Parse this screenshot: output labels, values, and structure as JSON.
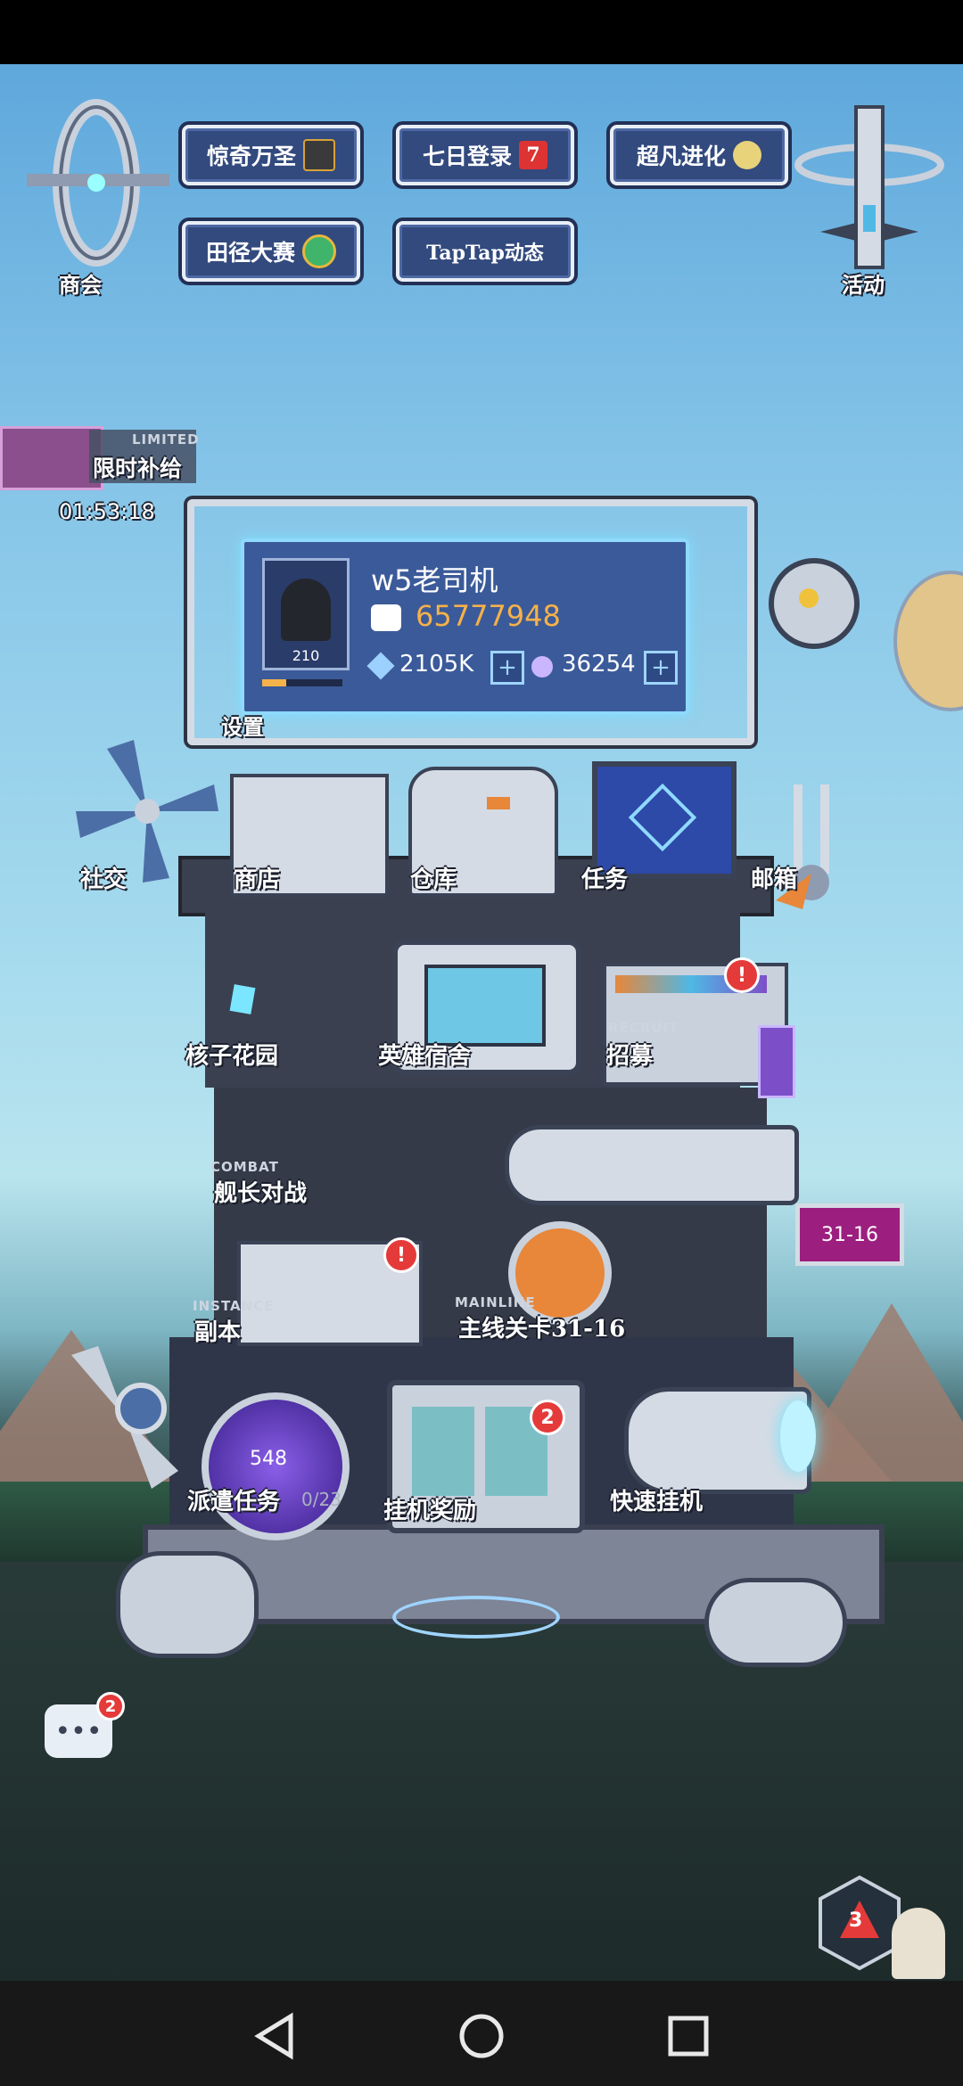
{
  "top_menu": {
    "guild": "商会",
    "events": "活动",
    "buttons": [
      {
        "label": "惊奇万圣"
      },
      {
        "label": "七日登录"
      },
      {
        "label": "超凡进化"
      },
      {
        "label": "田径大赛"
      },
      {
        "label": "TapTap动态"
      }
    ]
  },
  "limited_supply": {
    "tag": "LIMITED",
    "label": "限时补给",
    "timer": "01:53:18"
  },
  "profile": {
    "name": "w5老司机",
    "power": "65777948",
    "level": "210",
    "currency1": "2105K",
    "currency2": "36254",
    "settings": "设置"
  },
  "stations": {
    "social": "社交",
    "shop": "商店",
    "warehouse": "仓库",
    "tasks": "任务",
    "mailbox": "邮箱",
    "core_garden": "核子花园",
    "hero_dorm": "英雄宿舍",
    "recruit_tag": "RECRUIT",
    "recruit": "招募",
    "combat_tag": "COMBAT",
    "captain_battle": "舰长对战",
    "instance_tag": "INSTANCE",
    "instance": "副本",
    "mainline_tag": "MAINLINE",
    "mainline": "主线关卡31-16",
    "dispatch": "派遣任务",
    "dispatch_count": "0/23",
    "dispatch_value": "548",
    "idle_reward": "挂机奖励",
    "quick_idle": "快速挂机",
    "stage_badge": "31-16"
  },
  "badges": {
    "idle_reward": "2",
    "chat": "2",
    "dice": "3"
  },
  "colors": {
    "accent": "#8fd9ff",
    "badge": "#e53a3a",
    "power": "#f5b14a"
  }
}
